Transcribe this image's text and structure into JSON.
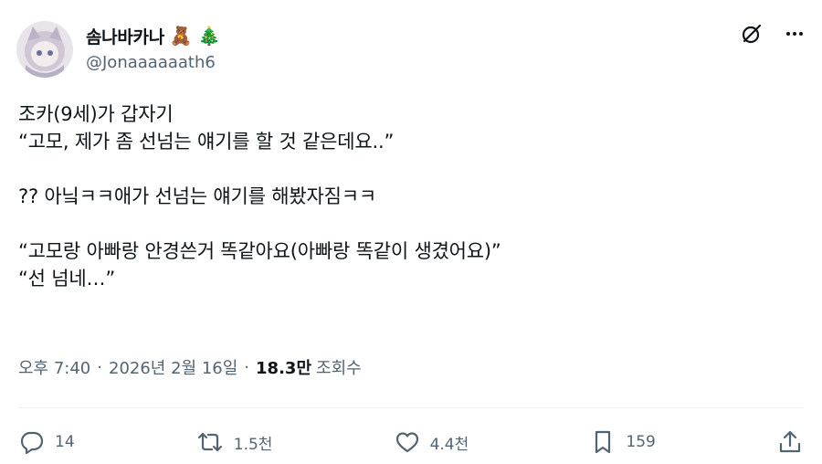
{
  "author": {
    "display_name": "솜나바카나",
    "name_emojis": [
      "🧸",
      "🎄"
    ],
    "handle": "@Jonaaaaaath6"
  },
  "icons": {
    "grok": "grok-icon",
    "more": "more-icon"
  },
  "tweet": {
    "lines": [
      "조카(9세)가 갑자기",
      "“고모, 제가 좀 선넘는 얘기를 할 것 같은데요..”",
      "",
      "?? 아닠ㅋㅋ애가 선넘는 얘기를 해봤자짐ㅋㅋ",
      "",
      "“고모랑 아빠랑 안경쓴거 똑같아요(아빠랑 똑같이 생겼어요)”",
      "“선 넘네…”"
    ]
  },
  "meta": {
    "time": "오후 7:40",
    "date": "2026년 2월 16일",
    "separator": "·",
    "views_count": "18.3만",
    "views_label": "조회수"
  },
  "actions": {
    "reply": "14",
    "retweet": "1.5천",
    "like": "4.4천",
    "bookmark": "159"
  },
  "colors": {
    "text": "#0f1419",
    "secondary": "#536471",
    "divider": "#eff3f4"
  }
}
